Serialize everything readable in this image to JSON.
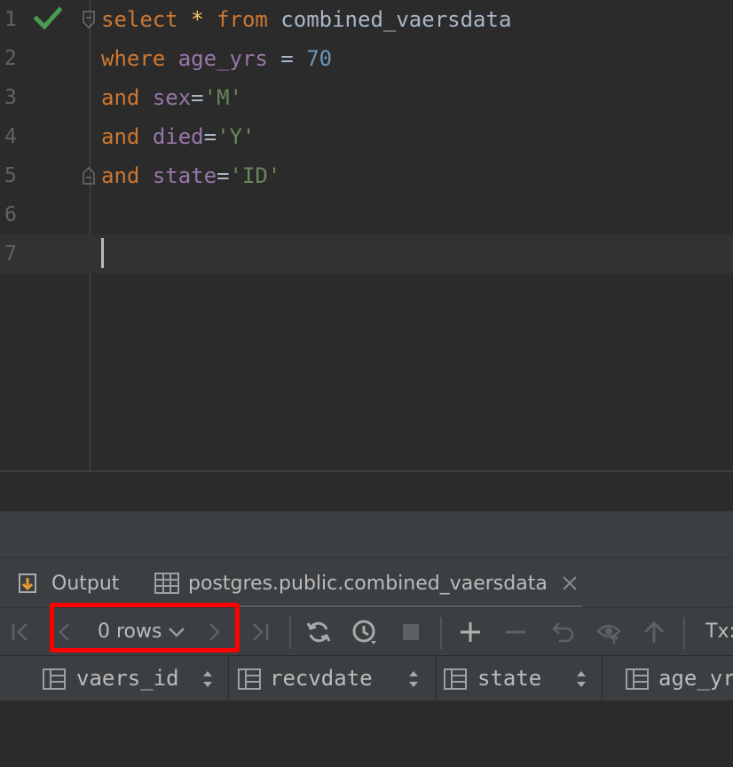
{
  "editor": {
    "lines": [
      {
        "num": "1",
        "tokens": [
          {
            "t": "select",
            "c": "kw"
          },
          {
            "t": " ",
            "c": "ident"
          },
          {
            "t": "*",
            "c": "op"
          },
          {
            "t": " ",
            "c": "ident"
          },
          {
            "t": "from",
            "c": "kw"
          },
          {
            "t": " combined_vaersdata",
            "c": "ident"
          }
        ]
      },
      {
        "num": "2",
        "tokens": [
          {
            "t": "where",
            "c": "kw"
          },
          {
            "t": " ",
            "c": "ident"
          },
          {
            "t": "age_yrs",
            "c": "col"
          },
          {
            "t": " = ",
            "c": "ident"
          },
          {
            "t": "70",
            "c": "num"
          }
        ]
      },
      {
        "num": "3",
        "tokens": [
          {
            "t": "and",
            "c": "kw"
          },
          {
            "t": " ",
            "c": "ident"
          },
          {
            "t": "sex",
            "c": "col"
          },
          {
            "t": "=",
            "c": "ident"
          },
          {
            "t": "'M'",
            "c": "str"
          }
        ]
      },
      {
        "num": "4",
        "tokens": [
          {
            "t": "and",
            "c": "kw"
          },
          {
            "t": " ",
            "c": "ident"
          },
          {
            "t": "died",
            "c": "col"
          },
          {
            "t": "=",
            "c": "ident"
          },
          {
            "t": "'Y'",
            "c": "str"
          }
        ]
      },
      {
        "num": "5",
        "tokens": [
          {
            "t": "and",
            "c": "kw"
          },
          {
            "t": " ",
            "c": "ident"
          },
          {
            "t": "state",
            "c": "col"
          },
          {
            "t": "=",
            "c": "ident"
          },
          {
            "t": "'ID'",
            "c": "str"
          }
        ]
      },
      {
        "num": "6",
        "tokens": []
      },
      {
        "num": "7",
        "tokens": []
      }
    ]
  },
  "tabs": {
    "output_label": "Output",
    "result_label": "postgres.public.combined_vaersdata"
  },
  "toolbar": {
    "rows_label": "0 rows",
    "tx_label": "Tx:"
  },
  "grid": {
    "columns": [
      "vaers_id",
      "recvdate",
      "state",
      "age_yrs"
    ]
  },
  "colors": {
    "background": "#2b2b2b",
    "keyword": "#cc7832",
    "string": "#6a8759",
    "number": "#6897bb",
    "column": "#9876aa",
    "highlight_box": "#ff0000",
    "check": "#499c54"
  },
  "icons": {
    "line1_status": "checkmark-icon",
    "output_tab": "output-icon",
    "result_tab": "table-icon"
  }
}
